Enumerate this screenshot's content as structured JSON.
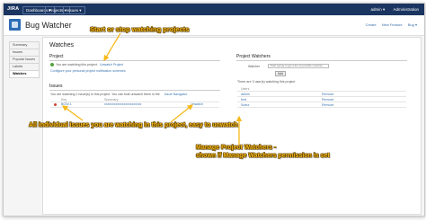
{
  "topbar": {
    "logo": "JIRA",
    "nav": [
      "Dashboards ▾",
      "Projects ▾",
      "Issues ▾"
    ],
    "user": "admin ▾",
    "admin": "Administration"
  },
  "header": {
    "project_title": "Bug Watcher",
    "links": [
      "Create",
      "New Feature",
      "Bug ▾"
    ]
  },
  "sidebar": {
    "items": [
      "Summary",
      "Issues",
      "Popular Issues",
      "Labels",
      "Watches"
    ]
  },
  "main": {
    "title": "Watches",
    "project_section": {
      "heading": "Project",
      "watching_text": "You are watching this project.",
      "unwatch_link": "Unwatch Project",
      "configure_text": "Configure your personal project notification schemes"
    },
    "issues_section": {
      "heading": "Issues",
      "info_text": "You are watching 1 issue(s) in this project. You can bulk unwatch them in the",
      "info_link": "Issue Navigator.",
      "columns": [
        "Key",
        "Summary"
      ],
      "rows": [
        {
          "key": "BGW-1",
          "summary": "xxxxxxxxxxxxxxxxxxxxxxx",
          "action": "Unwatch"
        }
      ]
    },
    "watchers_section": {
      "heading": "Project Watchers",
      "watcher_label": "Watcher",
      "input_placeholder": "Start typing to get a list of possible matches",
      "add_button": "Add",
      "count_text": "There are 3 user(s) watching this project",
      "column": "Users",
      "rows": [
        {
          "user": "admin",
          "action": "Remove"
        },
        {
          "user": "fred",
          "action": "Remove"
        },
        {
          "user": "Sueur",
          "action": "Remove"
        }
      ]
    }
  },
  "annotations": {
    "top": "Start or stop watching projects",
    "left": "All individual issues you are watching in this project, easy to unwatch",
    "right_line1": "Manage Project Watchers  -",
    "right_line2": "shown if Manage Watchers permission is set"
  },
  "colors": {
    "topbar": "#1a3560",
    "annotation": "#f6b91a",
    "link": "#3b73af"
  }
}
